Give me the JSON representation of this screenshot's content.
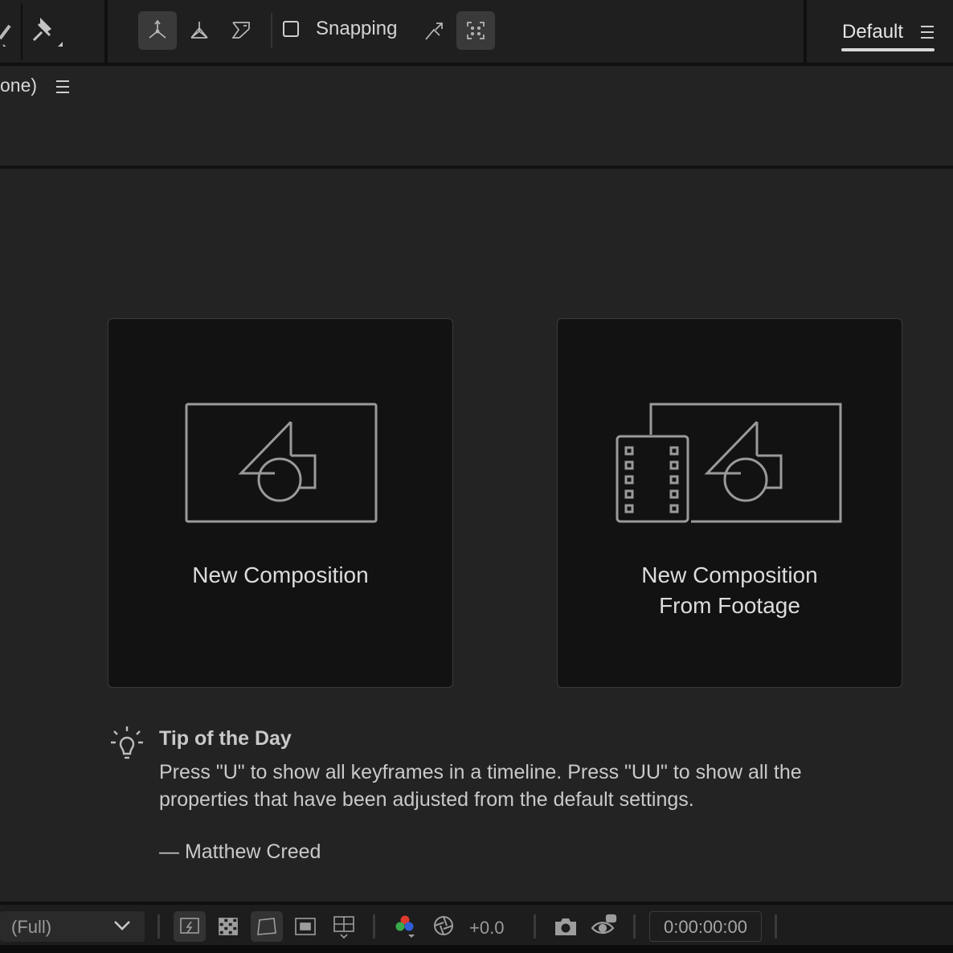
{
  "toolbar": {
    "snapping_label": "Snapping",
    "workspace_label": "Default"
  },
  "panel": {
    "title": "one)"
  },
  "cards": {
    "new_composition": "New Composition",
    "new_from_footage_line1": "New Composition",
    "new_from_footage_line2": "From Footage"
  },
  "tip": {
    "title": "Tip of the Day",
    "body": "Press \"U\" to show all keyframes in a timeline. Press \"UU\" to show all the properties that have been adjusted from the default settings.",
    "author": "— Matthew Creed"
  },
  "bottom_bar": {
    "resolution": "(Full)",
    "exposure": "+0.0",
    "timecode": "0:00:00:00"
  },
  "icons": {
    "lightbulb": "lightbulb-icon",
    "camera": "camera-icon",
    "color_channels": "color-channels-icon"
  },
  "colors": {
    "background": "#232323",
    "card": "#121212",
    "toolbar": "#1f1f1f"
  }
}
